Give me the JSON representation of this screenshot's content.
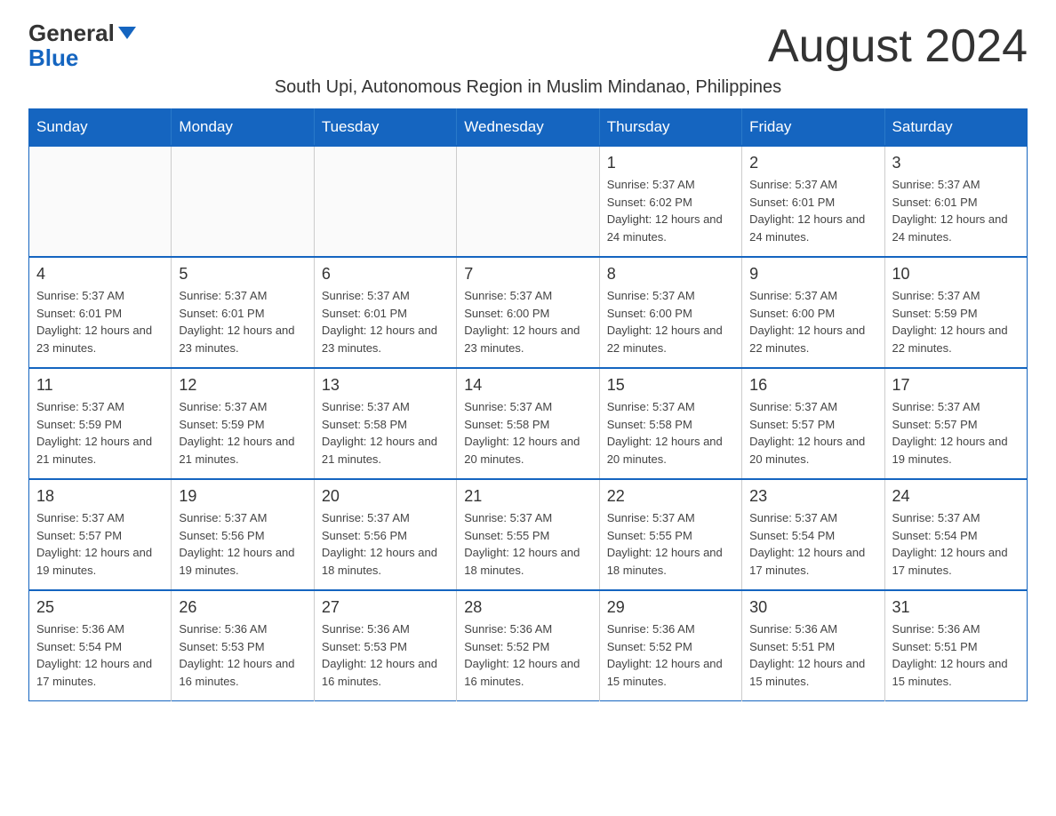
{
  "logo": {
    "top": "General",
    "bottom": "Blue"
  },
  "title": "August 2024",
  "subtitle": "South Upi, Autonomous Region in Muslim Mindanao, Philippines",
  "days_of_week": [
    "Sunday",
    "Monday",
    "Tuesday",
    "Wednesday",
    "Thursday",
    "Friday",
    "Saturday"
  ],
  "weeks": [
    [
      {
        "day": "",
        "info": ""
      },
      {
        "day": "",
        "info": ""
      },
      {
        "day": "",
        "info": ""
      },
      {
        "day": "",
        "info": ""
      },
      {
        "day": "1",
        "info": "Sunrise: 5:37 AM\nSunset: 6:02 PM\nDaylight: 12 hours and 24 minutes."
      },
      {
        "day": "2",
        "info": "Sunrise: 5:37 AM\nSunset: 6:01 PM\nDaylight: 12 hours and 24 minutes."
      },
      {
        "day": "3",
        "info": "Sunrise: 5:37 AM\nSunset: 6:01 PM\nDaylight: 12 hours and 24 minutes."
      }
    ],
    [
      {
        "day": "4",
        "info": "Sunrise: 5:37 AM\nSunset: 6:01 PM\nDaylight: 12 hours and 23 minutes."
      },
      {
        "day": "5",
        "info": "Sunrise: 5:37 AM\nSunset: 6:01 PM\nDaylight: 12 hours and 23 minutes."
      },
      {
        "day": "6",
        "info": "Sunrise: 5:37 AM\nSunset: 6:01 PM\nDaylight: 12 hours and 23 minutes."
      },
      {
        "day": "7",
        "info": "Sunrise: 5:37 AM\nSunset: 6:00 PM\nDaylight: 12 hours and 23 minutes."
      },
      {
        "day": "8",
        "info": "Sunrise: 5:37 AM\nSunset: 6:00 PM\nDaylight: 12 hours and 22 minutes."
      },
      {
        "day": "9",
        "info": "Sunrise: 5:37 AM\nSunset: 6:00 PM\nDaylight: 12 hours and 22 minutes."
      },
      {
        "day": "10",
        "info": "Sunrise: 5:37 AM\nSunset: 5:59 PM\nDaylight: 12 hours and 22 minutes."
      }
    ],
    [
      {
        "day": "11",
        "info": "Sunrise: 5:37 AM\nSunset: 5:59 PM\nDaylight: 12 hours and 21 minutes."
      },
      {
        "day": "12",
        "info": "Sunrise: 5:37 AM\nSunset: 5:59 PM\nDaylight: 12 hours and 21 minutes."
      },
      {
        "day": "13",
        "info": "Sunrise: 5:37 AM\nSunset: 5:58 PM\nDaylight: 12 hours and 21 minutes."
      },
      {
        "day": "14",
        "info": "Sunrise: 5:37 AM\nSunset: 5:58 PM\nDaylight: 12 hours and 20 minutes."
      },
      {
        "day": "15",
        "info": "Sunrise: 5:37 AM\nSunset: 5:58 PM\nDaylight: 12 hours and 20 minutes."
      },
      {
        "day": "16",
        "info": "Sunrise: 5:37 AM\nSunset: 5:57 PM\nDaylight: 12 hours and 20 minutes."
      },
      {
        "day": "17",
        "info": "Sunrise: 5:37 AM\nSunset: 5:57 PM\nDaylight: 12 hours and 19 minutes."
      }
    ],
    [
      {
        "day": "18",
        "info": "Sunrise: 5:37 AM\nSunset: 5:57 PM\nDaylight: 12 hours and 19 minutes."
      },
      {
        "day": "19",
        "info": "Sunrise: 5:37 AM\nSunset: 5:56 PM\nDaylight: 12 hours and 19 minutes."
      },
      {
        "day": "20",
        "info": "Sunrise: 5:37 AM\nSunset: 5:56 PM\nDaylight: 12 hours and 18 minutes."
      },
      {
        "day": "21",
        "info": "Sunrise: 5:37 AM\nSunset: 5:55 PM\nDaylight: 12 hours and 18 minutes."
      },
      {
        "day": "22",
        "info": "Sunrise: 5:37 AM\nSunset: 5:55 PM\nDaylight: 12 hours and 18 minutes."
      },
      {
        "day": "23",
        "info": "Sunrise: 5:37 AM\nSunset: 5:54 PM\nDaylight: 12 hours and 17 minutes."
      },
      {
        "day": "24",
        "info": "Sunrise: 5:37 AM\nSunset: 5:54 PM\nDaylight: 12 hours and 17 minutes."
      }
    ],
    [
      {
        "day": "25",
        "info": "Sunrise: 5:36 AM\nSunset: 5:54 PM\nDaylight: 12 hours and 17 minutes."
      },
      {
        "day": "26",
        "info": "Sunrise: 5:36 AM\nSunset: 5:53 PM\nDaylight: 12 hours and 16 minutes."
      },
      {
        "day": "27",
        "info": "Sunrise: 5:36 AM\nSunset: 5:53 PM\nDaylight: 12 hours and 16 minutes."
      },
      {
        "day": "28",
        "info": "Sunrise: 5:36 AM\nSunset: 5:52 PM\nDaylight: 12 hours and 16 minutes."
      },
      {
        "day": "29",
        "info": "Sunrise: 5:36 AM\nSunset: 5:52 PM\nDaylight: 12 hours and 15 minutes."
      },
      {
        "day": "30",
        "info": "Sunrise: 5:36 AM\nSunset: 5:51 PM\nDaylight: 12 hours and 15 minutes."
      },
      {
        "day": "31",
        "info": "Sunrise: 5:36 AM\nSunset: 5:51 PM\nDaylight: 12 hours and 15 minutes."
      }
    ]
  ]
}
